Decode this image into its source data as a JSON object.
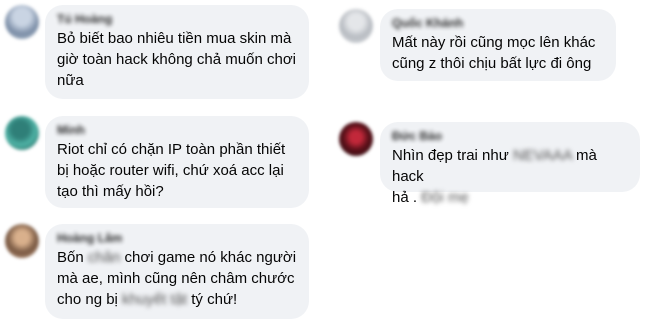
{
  "comments": [
    {
      "author": "Tú Hoàng",
      "text": "Bỏ biết bao nhiêu tiền mua skin mà\ngiờ toàn hack không chả muốn chơi\nnữa"
    },
    {
      "author": "Minh",
      "text": "Riot chỉ có chặn IP toàn phần thiết\nbị hoặc router wifi, chứ xoá acc lại\ntạo thì mấy hồi?"
    },
    {
      "author": "Hoàng Lâm",
      "text_before": "Bốn ",
      "text_blur_1": "chân",
      "text_middle": " chơi game nó khác người\nmà ae, mình cũng nên châm chước\ncho ng bị ",
      "text_blur_2": "khuyết tật",
      "text_after": " tý chứ!"
    },
    {
      "author": "Quốc Khánh",
      "text": "Mất này rồi cũng mọc lên khác\ncũng z thôi chịu bất lực đi ông"
    },
    {
      "author": "Đức Bảo",
      "text_before": "Nhìn đẹp trai như ",
      "text_blur_1": "NEVAAA",
      "text_middle": " mà hack\nhả . ",
      "text_blur_2": "Đội mẹ",
      "text_after": ""
    }
  ],
  "colors": {
    "bubble": "#f0f2f5",
    "text": "#050505"
  }
}
